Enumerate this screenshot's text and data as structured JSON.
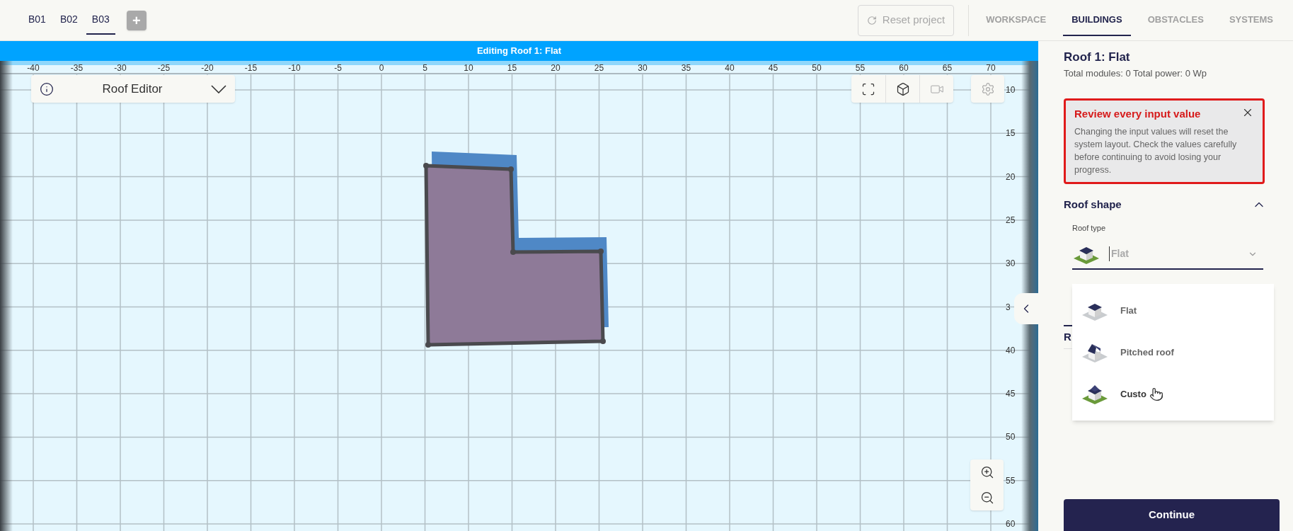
{
  "building_tabs": [
    {
      "label": "B01",
      "selected": false
    },
    {
      "label": "B02",
      "selected": false
    },
    {
      "label": "B03",
      "selected": true
    }
  ],
  "add_building": "+",
  "reset_button": {
    "label": "Reset project",
    "disabled": true
  },
  "nav_tabs": [
    {
      "label": "WORKSPACE",
      "selected": false
    },
    {
      "label": "BUILDINGS",
      "selected": true
    },
    {
      "label": "OBSTACLES",
      "selected": false
    },
    {
      "label": "SYSTEMS",
      "selected": false
    }
  ],
  "banner": "Editing Roof 1: Flat",
  "editor_panel": {
    "title": "Roof Editor"
  },
  "toolbar": [
    {
      "kind": "fullscreen",
      "disabled": false
    },
    {
      "kind": "view3d",
      "disabled": false
    },
    {
      "kind": "camera",
      "disabled": true
    }
  ],
  "x_ruler": [
    "-40",
    "-35",
    "-30",
    "-25",
    "-20",
    "-15",
    "-10",
    "-5",
    "0",
    "5",
    "10",
    "15",
    "20",
    "25",
    "30",
    "35",
    "40",
    "45",
    "50",
    "55",
    "60",
    "65",
    "70"
  ],
  "y_ruler": [
    "10",
    "15",
    "20",
    "25",
    "30",
    "3",
    "40",
    "45",
    "50",
    "55",
    "60"
  ],
  "panel": {
    "title": "Roof 1: Flat",
    "subtitle": "Total modules: 0 Total power: 0 Wp",
    "warning": {
      "title": "Review every input value",
      "text": "Changing the input values will reset the system layout. Check the values carefully before continuing to avoid losing your progress."
    },
    "section": {
      "title": "Roof shape",
      "expanded": true
    },
    "roof_type": {
      "label": "Roof type",
      "value": "Flat"
    },
    "options": [
      {
        "kind": "flat",
        "label": "Flat"
      },
      {
        "kind": "pitched",
        "label": "Pitched roof"
      },
      {
        "kind": "custom",
        "label": "Custo"
      }
    ],
    "hidden_section": "R",
    "continue": "Continue"
  }
}
